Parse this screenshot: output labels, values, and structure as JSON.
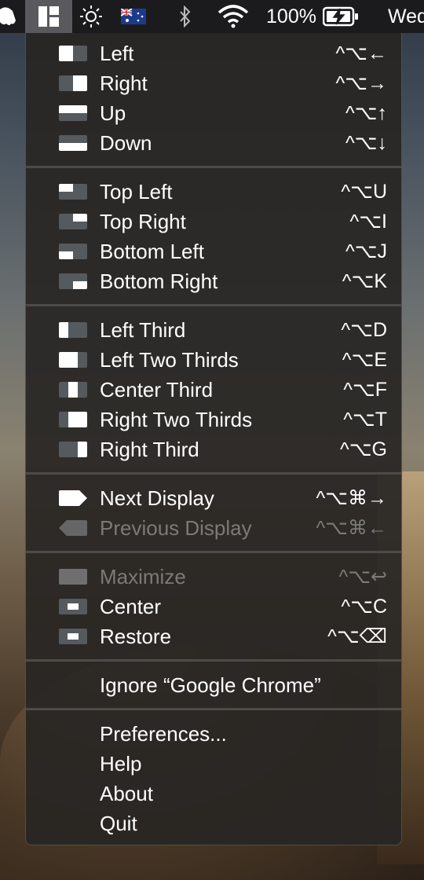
{
  "menubar": {
    "sound_icon": "ghost-icon",
    "battery_percent": "100%",
    "clock_partial": "Wed"
  },
  "menu": {
    "groups": [
      [
        {
          "label": "Left",
          "shortcut": "^⌥←"
        },
        {
          "label": "Right",
          "shortcut": "^⌥→"
        },
        {
          "label": "Up",
          "shortcut": "^⌥↑"
        },
        {
          "label": "Down",
          "shortcut": "^⌥↓"
        }
      ],
      [
        {
          "label": "Top Left",
          "shortcut": "^⌥U"
        },
        {
          "label": "Top Right",
          "shortcut": "^⌥I"
        },
        {
          "label": "Bottom Left",
          "shortcut": "^⌥J"
        },
        {
          "label": "Bottom Right",
          "shortcut": "^⌥K"
        }
      ],
      [
        {
          "label": "Left Third",
          "shortcut": "^⌥D"
        },
        {
          "label": "Left Two Thirds",
          "shortcut": "^⌥E"
        },
        {
          "label": "Center Third",
          "shortcut": "^⌥F"
        },
        {
          "label": "Right Two Thirds",
          "shortcut": "^⌥T"
        },
        {
          "label": "Right Third",
          "shortcut": "^⌥G"
        }
      ],
      [
        {
          "label": "Next Display",
          "shortcut": "^⌥⌘→"
        },
        {
          "label": "Previous Display",
          "shortcut": "^⌥⌘←",
          "disabled": true
        }
      ],
      [
        {
          "label": "Maximize",
          "shortcut": "^⌥↩",
          "disabled": true
        },
        {
          "label": "Center",
          "shortcut": "^⌥C"
        },
        {
          "label": "Restore",
          "shortcut": "^⌥⌫"
        }
      ],
      [
        {
          "label": "Ignore “Google Chrome”"
        }
      ],
      [
        {
          "label": "Preferences..."
        },
        {
          "label": "Help"
        },
        {
          "label": "About"
        },
        {
          "label": "Quit"
        }
      ]
    ]
  }
}
